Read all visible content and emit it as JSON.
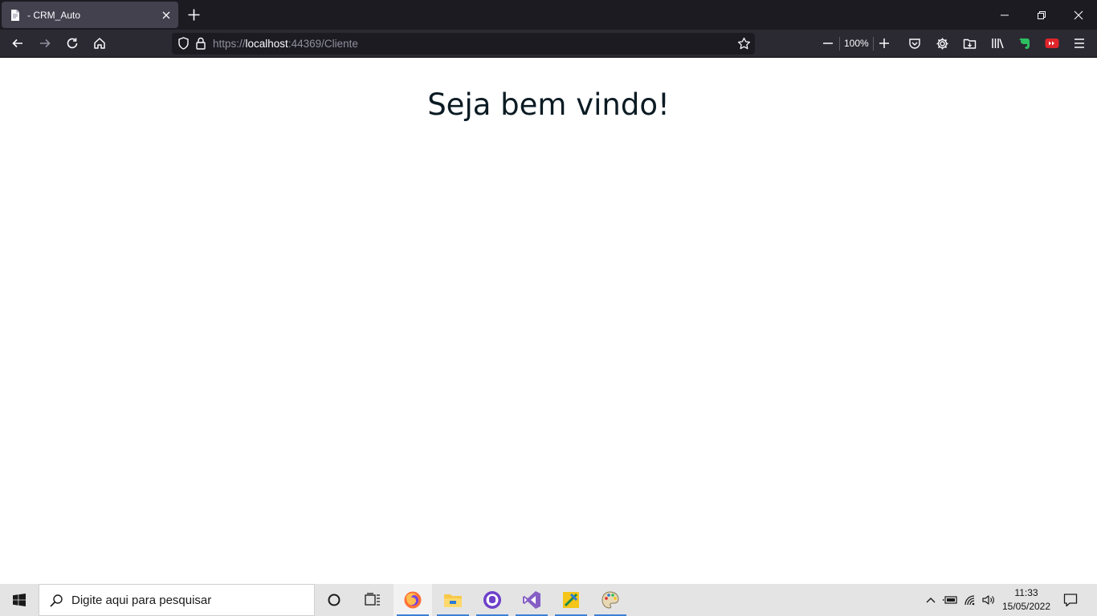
{
  "browser": {
    "tab": {
      "title": "- CRM_Auto"
    },
    "url": {
      "scheme": "https://",
      "host": "localhost",
      "rest": ":44369/Cliente"
    },
    "zoom": "100%",
    "icons": {
      "tab_favicon": "page-icon",
      "tab_close": "close-icon",
      "new_tab": "plus-icon",
      "back": "back-arrow-icon",
      "forward": "forward-arrow-icon",
      "reload": "reload-icon",
      "home": "home-icon",
      "tracking_protection": "shield-icon",
      "lock": "lock-icon",
      "bookmark": "star-icon",
      "zoom_out": "minus-icon",
      "zoom_in": "plus-icon",
      "pocket": "pocket-icon",
      "settings": "gear-icon",
      "downloads": "folder-icon",
      "library": "library-icon",
      "evernote": "evernote-icon",
      "video_ext": "video-extension-icon",
      "menu": "hamburger-menu-icon",
      "minimize": "minimize-icon",
      "restore": "restore-icon",
      "close_window": "close-icon"
    }
  },
  "page": {
    "heading": "Seja bem vindo!"
  },
  "taskbar": {
    "search_placeholder": "Digite aqui para pesquisar",
    "clock_time": "11:33",
    "clock_date": "15/05/2022",
    "apps": [
      "firefox-icon",
      "file-explorer-icon",
      "github-desktop-icon",
      "visual-studio-icon",
      "app-icon",
      "paint-icon"
    ]
  },
  "colors": {
    "tabstrip_bg": "#1c1b22",
    "toolbar_bg": "#2b2a33",
    "urlbar_bg": "#1c1b22",
    "heading_text": "#0b1b24",
    "taskbar_bg": "#e4e4e4",
    "taskbar_accent": "#3b7fd6"
  }
}
